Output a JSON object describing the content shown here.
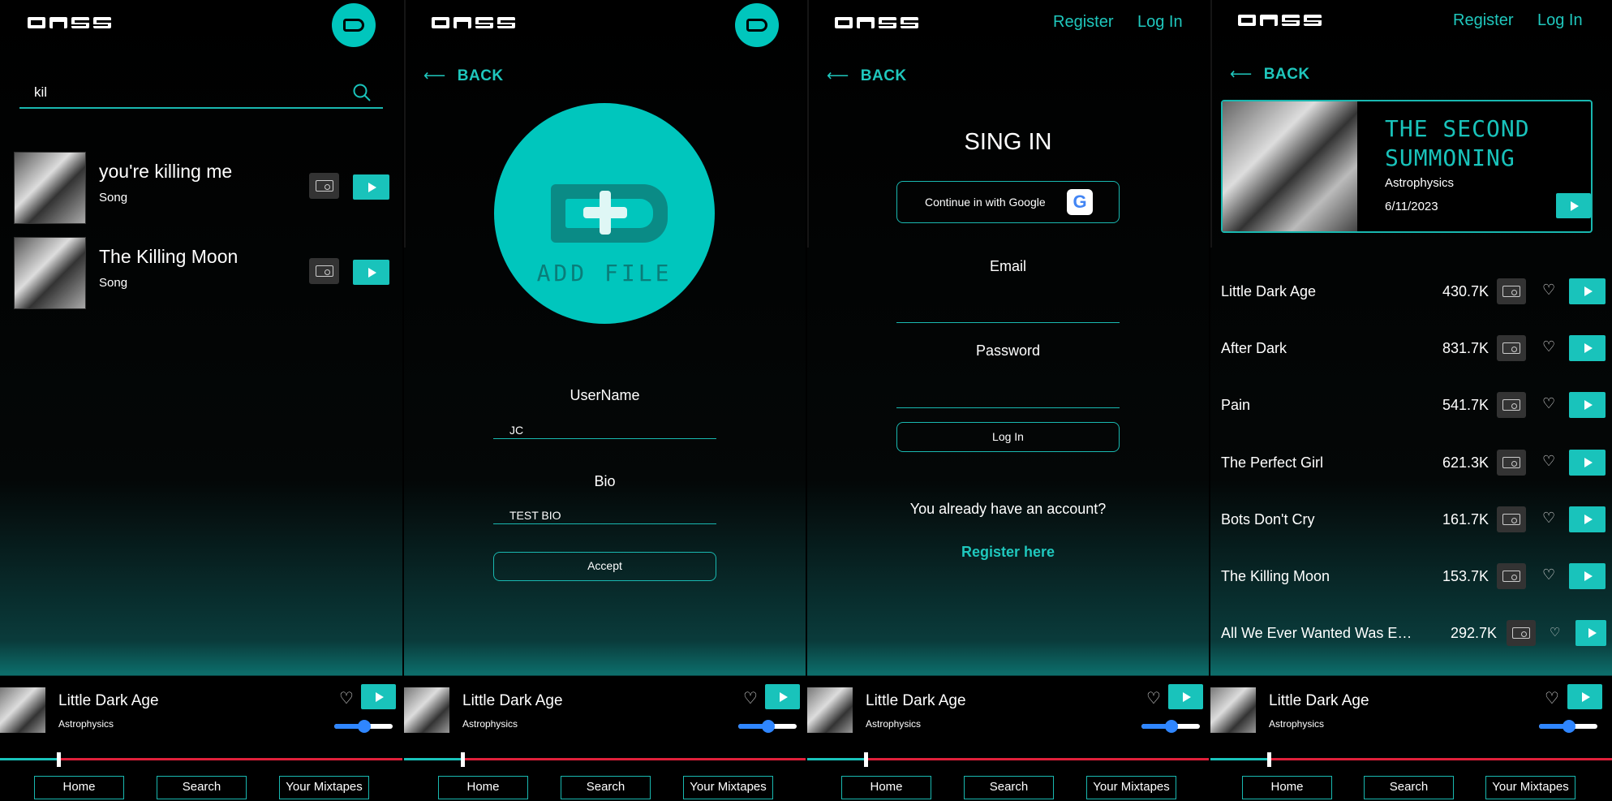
{
  "colors": {
    "accent": "#00c6bd",
    "progress_remaining": "#e0203a",
    "volume": "#2f86ff",
    "background": "#000000"
  },
  "icons": {
    "logo": "dass-logo",
    "search": "search-icon",
    "cassette": "cassette-icon",
    "play": "play-icon",
    "heart": "heart-icon",
    "google": "google-icon",
    "back": "arrow-left-icon"
  },
  "search": {
    "query": "kil"
  },
  "results": [
    {
      "title": "you're killing me",
      "type": "Song"
    },
    {
      "title": "The Killing Moon",
      "type": "Song"
    }
  ],
  "profile": {
    "back": "BACK",
    "add_file": "ADD FILE",
    "username_label": "UserName",
    "username_value": "JC",
    "bio_label": "Bio",
    "bio_value": "TEST BIO",
    "accept": "Accept"
  },
  "header": {
    "register": "Register",
    "login": "Log In"
  },
  "signin": {
    "back": "BACK",
    "title": "SING IN",
    "google": "Continue in with Google",
    "google_glyph": "G",
    "email_label": "Email",
    "password_label": "Password",
    "login_button": "Log In",
    "question": "You already have an account?",
    "register_link": "Register here"
  },
  "album": {
    "back": "BACK",
    "title": "THE SECOND SUMMONING",
    "artist": "Astrophysics",
    "date": "6/11/2023",
    "tracks": [
      {
        "name": "Little Dark Age",
        "plays": "430.7K"
      },
      {
        "name": "After Dark",
        "plays": "831.7K"
      },
      {
        "name": "Pain",
        "plays": "541.7K"
      },
      {
        "name": "The Perfect Girl",
        "plays": "621.3K"
      },
      {
        "name": "Bots Don't Cry",
        "plays": "161.7K"
      },
      {
        "name": "The Killing Moon",
        "plays": "153.7K"
      },
      {
        "name": "All We Ever Wanted Was Ev···",
        "plays": "292.7K"
      }
    ]
  },
  "player": {
    "song": "Little Dark Age",
    "artist": "Astrophysics",
    "progress": 0.145,
    "volume": 0.52
  },
  "nav": {
    "home": "Home",
    "search": "Search",
    "mixtapes": "Your Mixtapes"
  }
}
